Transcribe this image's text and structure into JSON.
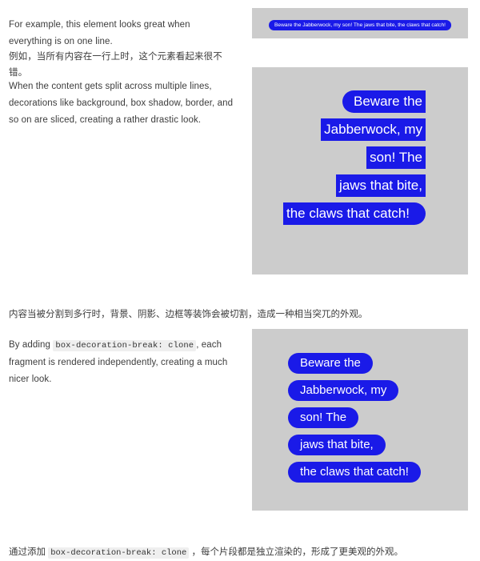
{
  "colors": {
    "page_background": "#ffffff",
    "panel_background": "#cccccc",
    "badge_blue": "#1a1ae8",
    "badge_text": "#ffffff",
    "body_text": "#3c3c3c",
    "code_background": "#efefef"
  },
  "prose": {
    "intro_en": "For example, this element looks great when everything is on one line.",
    "intro_cn": "例如，当所有内容在一行上时，这个元素看起来很不错。",
    "sliced_en": "When the content gets split across multiple lines, decorations like background, box shadow, border, and so on are sliced, creating a rather drastic look.",
    "sliced_cn": "内容当被分割到多行时，背景、阴影、边框等装饰会被切割，造成一种相当突兀的外观。",
    "clone_en_before": "By adding ",
    "clone_code": "box-decoration-break: clone",
    "clone_en_after": ", each fragment is rendered independently, creating a much nicer look.",
    "clone_cn_before": "通过添加 ",
    "clone_cn_after": " ，每个片段都是独立渲染的，形成了更美观的外观。"
  },
  "demos": {
    "oneline": {
      "label": "single-line-badge",
      "text": "Beware the Jabberwock, my son! The jaws that bite, the claws that catch!"
    },
    "sliced": {
      "label": "sliced-badge",
      "fragments": [
        "Beware the",
        "Jabberwock, my",
        "son! The",
        "jaws that bite,",
        "the claws that catch!"
      ]
    },
    "cloned": {
      "label": "cloned-badge",
      "fragments": [
        "Beware the",
        "Jabberwock, my",
        "son! The",
        "jaws that bite,",
        "the claws that catch!"
      ]
    }
  }
}
